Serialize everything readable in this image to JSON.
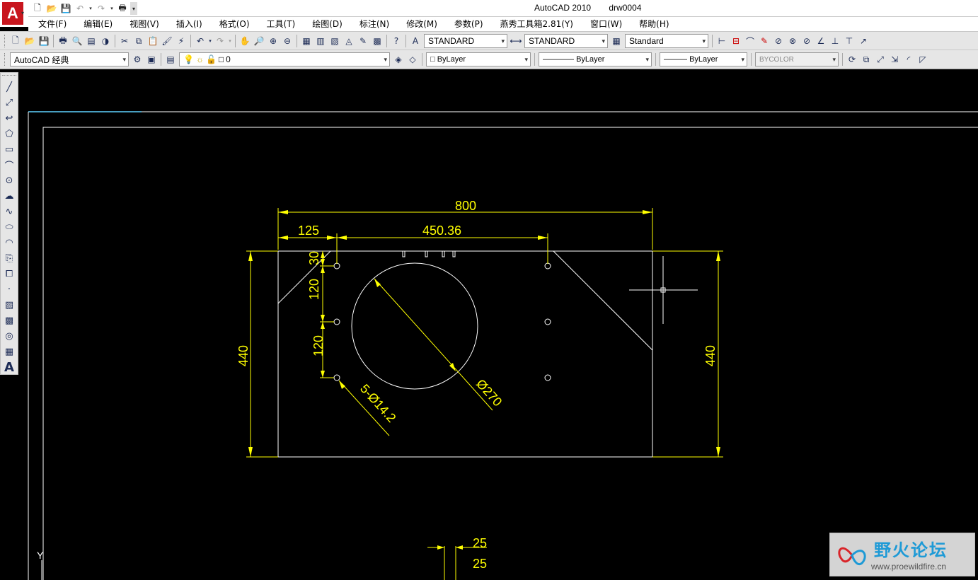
{
  "titlebar": {
    "app_name": "AutoCAD 2010",
    "file_name": "drw0004",
    "app_logo": "A"
  },
  "menu": [
    "文件(F)",
    "编辑(E)",
    "视图(V)",
    "插入(I)",
    "格式(O)",
    "工具(T)",
    "绘图(D)",
    "标注(N)",
    "修改(M)",
    "参数(P)",
    "燕秀工具箱2.81(Y)",
    "窗口(W)",
    "帮助(H)"
  ],
  "toolbar1": {
    "text_style": "STANDARD",
    "dim_style": "STANDARD",
    "table_style": "Standard"
  },
  "toolbar2": {
    "workspace": "AutoCAD 经典",
    "layer": "0",
    "color": "ByLayer",
    "linetype": "ByLayer",
    "lineweight": "ByLayer",
    "plotstyle": "BYCOLOR"
  },
  "drawing": {
    "dim_overall_width": "800",
    "dim_offset_left": "125",
    "dim_hole_spacing": "450.36",
    "dim_height_left": "440",
    "dim_height_right": "440",
    "dim_vert_30": "30",
    "dim_vert_120a": "120",
    "dim_vert_120b": "120",
    "dim_hole_callout": "5-Ø14.2",
    "dim_big_circle": "Ø270",
    "dim_bottom_25a": "25",
    "dim_bottom_25b": "25",
    "ucs_y": "Y"
  },
  "watermark": {
    "title": "野火论坛",
    "url": "www.proewildfire.cn"
  },
  "colors": {
    "dimension": "#ffff00",
    "geometry": "#ffffff",
    "background": "#000000",
    "crosshair": "#ffffff"
  }
}
